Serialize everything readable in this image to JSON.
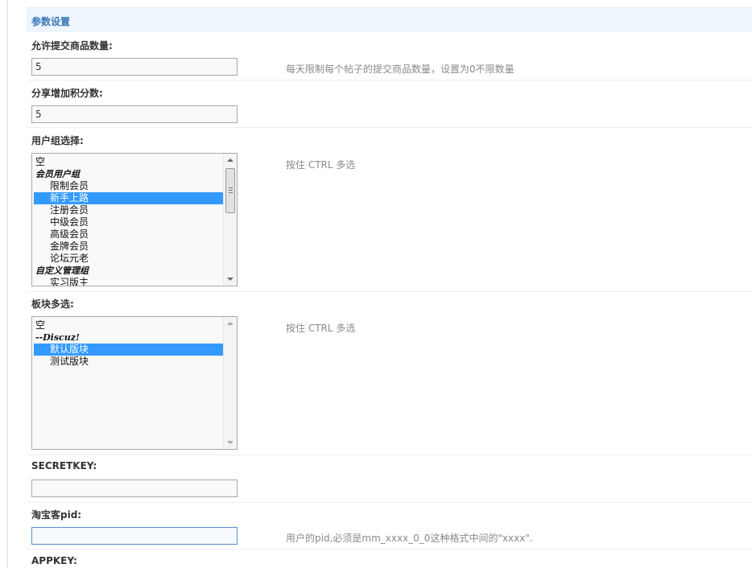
{
  "section": {
    "title": "参数设置"
  },
  "fields": {
    "max_goods": {
      "label": "允许提交商品数量:",
      "value": "5",
      "hint": "每天限制每个帖子的提交商品数量，设置为0不限数量"
    },
    "share_points": {
      "label": "分享增加积分数:",
      "value": "5"
    },
    "user_groups": {
      "label": "用户组选择:",
      "hint": "按住 CTRL 多选",
      "options": [
        {
          "text": "空",
          "kind": "opt",
          "selected": false
        },
        {
          "text": "会员用户组",
          "kind": "group",
          "selected": false
        },
        {
          "text": "限制会员",
          "kind": "child",
          "selected": false
        },
        {
          "text": "新手上路",
          "kind": "child",
          "selected": true
        },
        {
          "text": "注册会员",
          "kind": "child",
          "selected": false
        },
        {
          "text": "中级会员",
          "kind": "child",
          "selected": false
        },
        {
          "text": "高级会员",
          "kind": "child",
          "selected": false
        },
        {
          "text": "金牌会员",
          "kind": "child",
          "selected": false
        },
        {
          "text": "论坛元老",
          "kind": "child",
          "selected": false
        },
        {
          "text": "自定义管理组",
          "kind": "group",
          "selected": false
        },
        {
          "text": "实习版主",
          "kind": "child",
          "selected": false
        }
      ]
    },
    "forums": {
      "label": "板块多选:",
      "hint": "按住 CTRL 多选",
      "options": [
        {
          "text": "空",
          "kind": "opt",
          "selected": false
        },
        {
          "text": "--Discuz!",
          "kind": "group",
          "selected": false
        },
        {
          "text": "默认版块",
          "kind": "child",
          "selected": true
        },
        {
          "text": "测试版块",
          "kind": "child",
          "selected": false
        }
      ]
    },
    "secretkey": {
      "label": "SECRETKEY:",
      "value": ""
    },
    "pid": {
      "label": "淘宝客pid:",
      "value": "",
      "hint": "用户的pid,必须是mm_xxxx_0_0这种格式中间的\"xxxx\"."
    },
    "appkey": {
      "label": "APPKEY:"
    }
  }
}
